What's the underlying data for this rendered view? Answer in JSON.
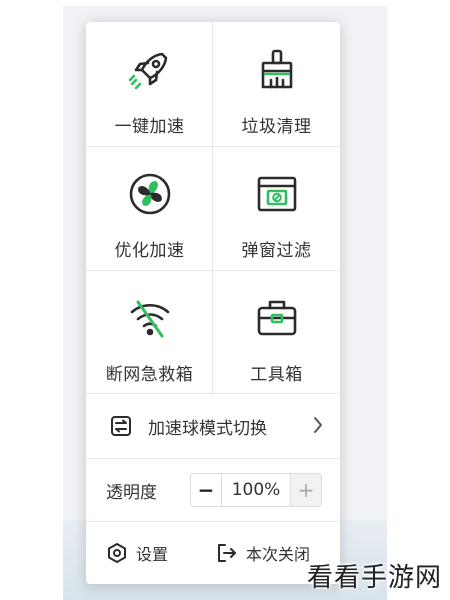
{
  "menu": {
    "grid": [
      {
        "label": "一键加速",
        "icon": "rocket-icon"
      },
      {
        "label": "垃圾清理",
        "icon": "broom-icon"
      },
      {
        "label": "优化加速",
        "icon": "fan-icon"
      },
      {
        "label": "弹窗过滤",
        "icon": "popup-block-icon"
      },
      {
        "label": "断网急救箱",
        "icon": "wifi-off-icon"
      },
      {
        "label": "工具箱",
        "icon": "toolbox-icon"
      }
    ],
    "mode_switch": {
      "label": "加速球模式切换",
      "icon": "switch-icon"
    },
    "opacity": {
      "label": "透明度",
      "minus": "−",
      "value": "100%",
      "plus": "+"
    },
    "settings": {
      "label": "设置",
      "icon": "gear-icon"
    },
    "close": {
      "label": "本次关闭",
      "icon": "exit-icon"
    }
  },
  "watermark": "看看手游网",
  "colors": {
    "accent_green": "#2fbf5f",
    "icon_dark": "#2b2b2b"
  }
}
